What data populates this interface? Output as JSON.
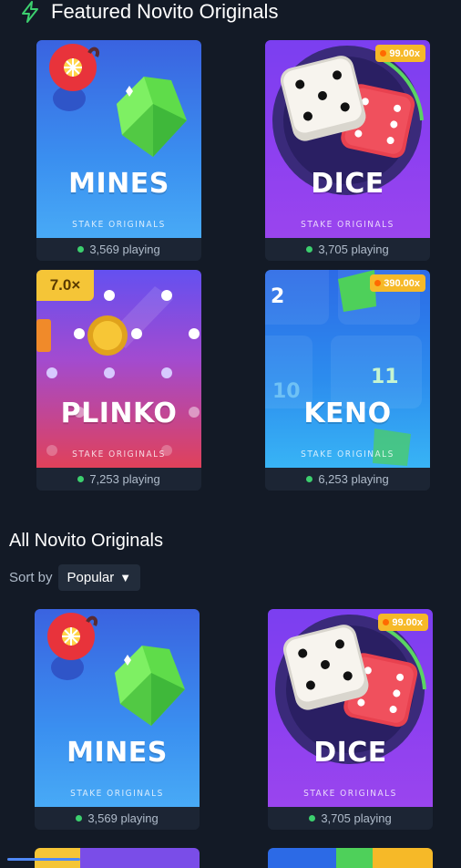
{
  "featured": {
    "title": "Featured Novito Originals",
    "cards": [
      {
        "name": "MINES",
        "brand": "STAKE ORIGINALS",
        "playing": "3,569 playing"
      },
      {
        "name": "DICE",
        "brand": "STAKE ORIGINALS",
        "playing": "3,705 playing",
        "multiplier": "99.00x"
      },
      {
        "name": "PLINKO",
        "brand": "STAKE ORIGINALS",
        "playing": "7,253 playing",
        "badge": "7.0×"
      },
      {
        "name": "KENO",
        "brand": "STAKE ORIGINALS",
        "playing": "6,253 playing",
        "multiplier": "390.00x",
        "tiles": [
          "2",
          "10",
          "11"
        ]
      }
    ]
  },
  "all": {
    "title": "All Novito Originals",
    "sort_label": "Sort by",
    "sort_value": "Popular",
    "cards": [
      {
        "name": "MINES",
        "brand": "STAKE ORIGINALS",
        "playing": "3,569 playing"
      },
      {
        "name": "DICE",
        "brand": "STAKE ORIGINALS",
        "playing": "3,705 playing",
        "multiplier": "99.00x"
      }
    ]
  },
  "colors": {
    "accent_green": "#3ccf6e",
    "background": "#131a26",
    "card_footer": "#1c2534"
  },
  "icons": {
    "section": "lightning-bolt-icon",
    "sort": "caret-down-icon"
  }
}
